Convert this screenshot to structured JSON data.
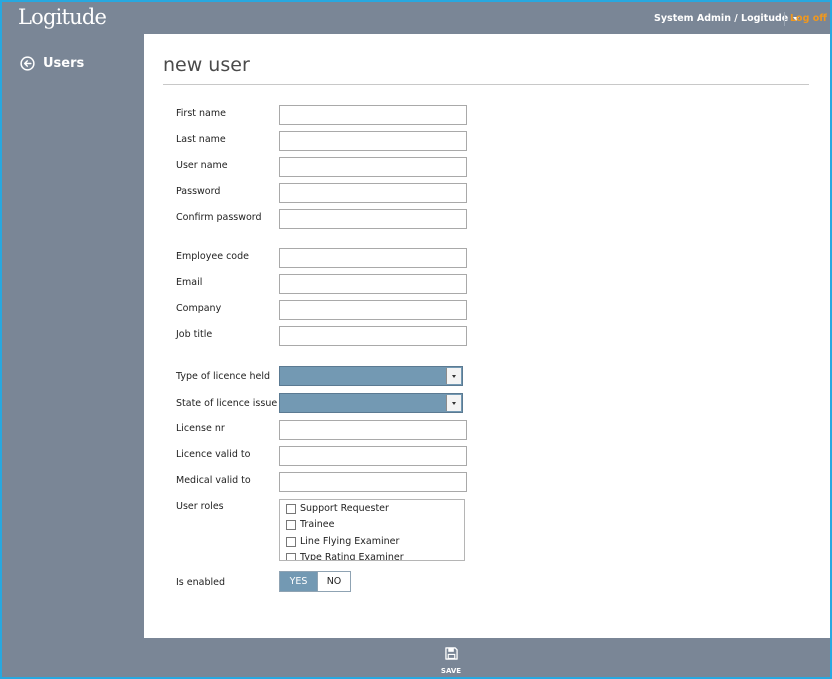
{
  "header": {
    "logo": "Logitude",
    "user_menu": "System Admin / Logitude",
    "logoff": "Log off"
  },
  "sidebar": {
    "back_label": "Users"
  },
  "main": {
    "title": "new user"
  },
  "form": {
    "first_name": {
      "label": "First name",
      "value": ""
    },
    "last_name": {
      "label": "Last name",
      "value": ""
    },
    "user_name": {
      "label": "User name",
      "value": ""
    },
    "password": {
      "label": "Password",
      "value": ""
    },
    "confirm_password": {
      "label": "Confirm password",
      "value": ""
    },
    "employee_code": {
      "label": "Employee code",
      "value": ""
    },
    "email": {
      "label": "Email",
      "value": ""
    },
    "company": {
      "label": "Company",
      "value": ""
    },
    "job_title": {
      "label": "Job title",
      "value": ""
    },
    "licence_type": {
      "label": "Type of licence held",
      "value": ""
    },
    "licence_state": {
      "label": "State of licence issue",
      "value": ""
    },
    "license_nr": {
      "label": "License nr",
      "value": ""
    },
    "licence_valid_to": {
      "label": "Licence valid to",
      "value": ""
    },
    "medical_valid_to": {
      "label": "Medical valid to",
      "value": ""
    },
    "user_roles": {
      "label": "User roles",
      "options": [
        "Support Requester",
        "Trainee",
        "Line Flying Examiner",
        "Type Rating Examiner"
      ]
    },
    "is_enabled": {
      "label": "Is enabled",
      "yes": "YES",
      "no": "NO",
      "selected": "YES"
    }
  },
  "footer": {
    "save_label": "SAVE"
  },
  "colors": {
    "chrome": "#7a8696",
    "accent_blue": "#7399b3",
    "logoff_orange": "#f0981e",
    "frame_border": "#27a8e0"
  },
  "icons": {
    "back": "arrow-left-circle-icon",
    "save": "floppy-disk-icon",
    "dropdown": "caret-down-icon"
  }
}
